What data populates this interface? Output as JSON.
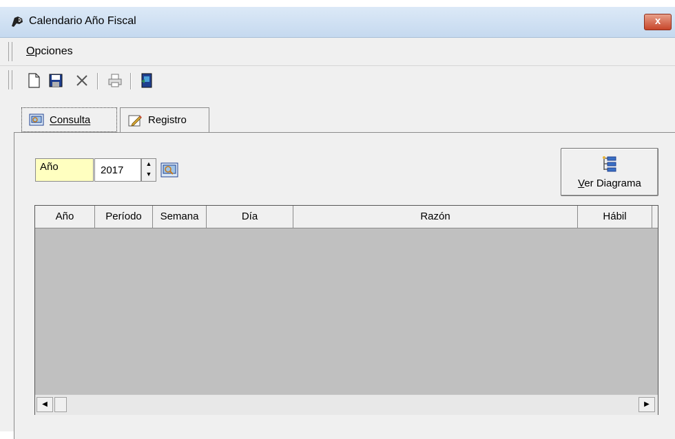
{
  "window": {
    "title": "Calendario Año Fiscal",
    "close_label": "x"
  },
  "menu": {
    "items": [
      {
        "label": "Opciones",
        "mnemonic": "O"
      }
    ]
  },
  "toolbar": {
    "buttons": [
      "new-icon",
      "save-icon",
      "delete-icon",
      "print-icon",
      "export-icon"
    ]
  },
  "tabs": [
    {
      "label": "Consulta",
      "active": true,
      "icon": "query-icon"
    },
    {
      "label": "Registro",
      "active": false,
      "icon": "edit-icon"
    }
  ],
  "filter": {
    "year_label": "Año",
    "year_value": "2017"
  },
  "diagram_button": {
    "label": "Ver Diagrama",
    "icon": "diagram-icon"
  },
  "grid": {
    "columns": [
      "Año",
      "Período",
      "Semana",
      "Día",
      "Razón",
      "Hábil"
    ],
    "rows": []
  },
  "colors": {
    "title_bar": "#c5d9ef",
    "close_button": "#c7452a",
    "year_label_bg": "#ffffc0",
    "grid_bg": "#c0c0c0"
  }
}
